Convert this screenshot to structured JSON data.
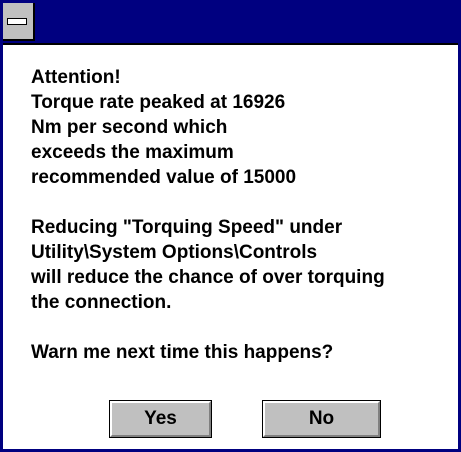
{
  "dialog": {
    "message_lines_1": [
      "Attention!",
      "Torque rate peaked at 16926",
      "Nm per second which",
      "exceeds the maximum",
      "recommended value of 15000"
    ],
    "message_lines_2": [
      "Reducing \"Torquing Speed\" under",
      "Utility\\System Options\\Controls",
      "will reduce the chance of over torquing",
      "the connection."
    ],
    "question": "Warn me next time this happens?",
    "buttons": {
      "yes_label": "Yes",
      "no_label": "No"
    }
  },
  "colors": {
    "titlebar": "#000080",
    "button_face": "#c0c0c0"
  },
  "icons": {
    "system_menu": "system-menu-icon"
  }
}
